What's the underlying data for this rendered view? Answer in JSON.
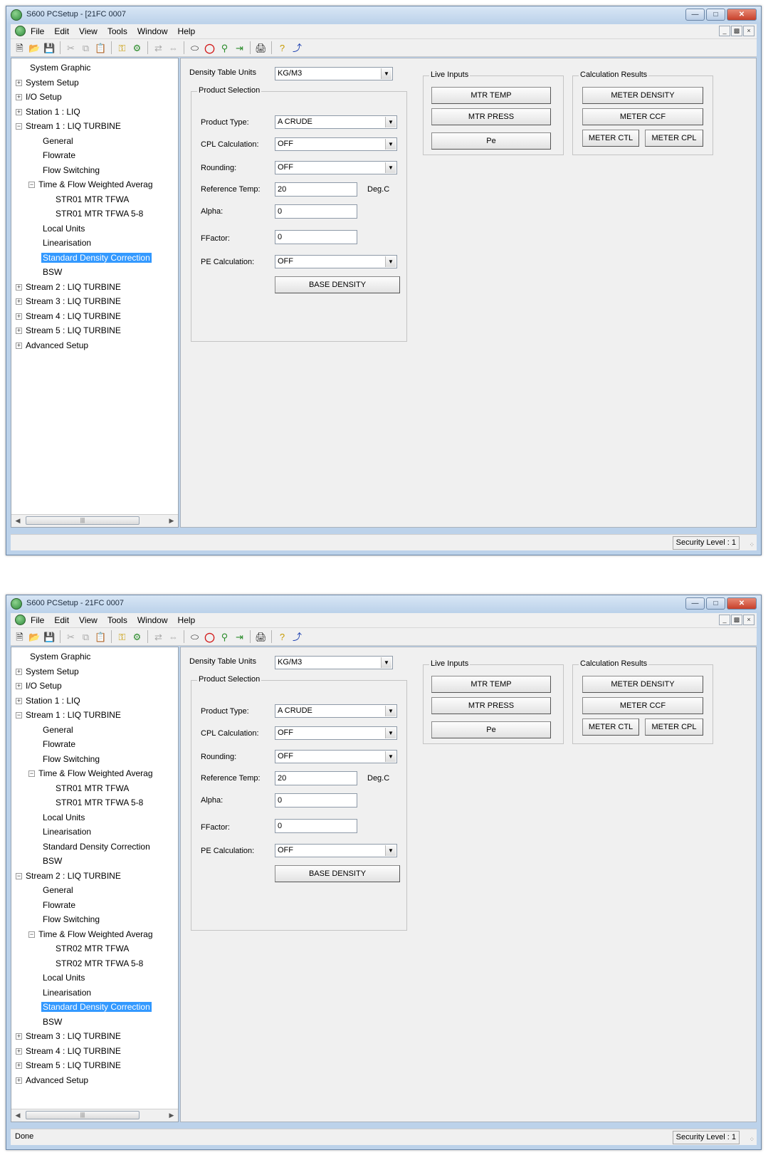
{
  "windows": [
    {
      "title": "S600 PCSetup - [21FC 0007",
      "menus": [
        "File",
        "Edit",
        "View",
        "Tools",
        "Window",
        "Help"
      ],
      "tree": [
        {
          "label": "System Graphic",
          "indent": 1,
          "expander": ""
        },
        {
          "label": "System Setup",
          "indent": 0,
          "expander": "+"
        },
        {
          "label": "I/O Setup",
          "indent": 0,
          "expander": "+"
        },
        {
          "label": "Station 1 : LIQ",
          "indent": 0,
          "expander": "+"
        },
        {
          "label": "Stream 1 : LIQ TURBINE",
          "indent": 0,
          "expander": "-"
        },
        {
          "label": "General",
          "indent": 2,
          "expander": ""
        },
        {
          "label": "Flowrate",
          "indent": 2,
          "expander": ""
        },
        {
          "label": "Flow Switching",
          "indent": 2,
          "expander": ""
        },
        {
          "label": "Time & Flow Weighted Averag",
          "indent": 1,
          "expander": "-"
        },
        {
          "label": "STR01 MTR TFWA",
          "indent": 3,
          "expander": ""
        },
        {
          "label": "STR01 MTR TFWA 5-8",
          "indent": 3,
          "expander": ""
        },
        {
          "label": "Local Units",
          "indent": 2,
          "expander": ""
        },
        {
          "label": "Linearisation",
          "indent": 2,
          "expander": ""
        },
        {
          "label": "Standard Density Correction",
          "indent": 2,
          "expander": "",
          "selected": true
        },
        {
          "label": "BSW",
          "indent": 2,
          "expander": ""
        },
        {
          "label": "Stream 2 : LIQ TURBINE",
          "indent": 0,
          "expander": "+"
        },
        {
          "label": "Stream 3 : LIQ TURBINE",
          "indent": 0,
          "expander": "+"
        },
        {
          "label": "Stream 4 : LIQ TURBINE",
          "indent": 0,
          "expander": "+"
        },
        {
          "label": "Stream 5 : LIQ TURBINE",
          "indent": 0,
          "expander": "+"
        },
        {
          "label": "Advanced Setup",
          "indent": 0,
          "expander": "+"
        }
      ],
      "form": {
        "density_table_units_label": "Density Table Units",
        "density_table_units_value": "KG/M3",
        "product_selection_label": "Product Selection",
        "product_type_label": "Product Type:",
        "product_type_value": "A CRUDE",
        "cpl_calc_label": "CPL Calculation:",
        "cpl_calc_value": "OFF",
        "rounding_label": "Rounding:",
        "rounding_value": "OFF",
        "ref_temp_label": "Reference Temp:",
        "ref_temp_value": "20",
        "ref_temp_unit": "Deg.C",
        "alpha_label": "Alpha:",
        "alpha_value": "0",
        "ffactor_label": "FFactor:",
        "ffactor_value": "0",
        "pe_calc_label": "PE Calculation:",
        "pe_calc_value": "OFF",
        "base_density_button": "BASE DENSITY",
        "live_inputs_label": "Live Inputs",
        "mtr_temp_button": "MTR TEMP",
        "mtr_press_button": "MTR PRESS",
        "pe_button": "Pe",
        "calc_results_label": "Calculation Results",
        "meter_density_button": "METER DENSITY",
        "meter_ccf_button": "METER CCF",
        "meter_ctl_button": "METER CTL",
        "meter_cpl_button": "METER CPL"
      },
      "status": {
        "left": "",
        "right": "Security Level : 1"
      }
    },
    {
      "title": "S600 PCSetup - 21FC 0007",
      "menus": [
        "File",
        "Edit",
        "View",
        "Tools",
        "Window",
        "Help"
      ],
      "tree": [
        {
          "label": "System Graphic",
          "indent": 1,
          "expander": ""
        },
        {
          "label": "System Setup",
          "indent": 0,
          "expander": "+"
        },
        {
          "label": "I/O Setup",
          "indent": 0,
          "expander": "+"
        },
        {
          "label": "Station 1 : LIQ",
          "indent": 0,
          "expander": "+"
        },
        {
          "label": "Stream 1 : LIQ TURBINE",
          "indent": 0,
          "expander": "-"
        },
        {
          "label": "General",
          "indent": 2,
          "expander": ""
        },
        {
          "label": "Flowrate",
          "indent": 2,
          "expander": ""
        },
        {
          "label": "Flow Switching",
          "indent": 2,
          "expander": ""
        },
        {
          "label": "Time & Flow Weighted Averag",
          "indent": 1,
          "expander": "-"
        },
        {
          "label": "STR01 MTR TFWA",
          "indent": 3,
          "expander": ""
        },
        {
          "label": "STR01 MTR TFWA 5-8",
          "indent": 3,
          "expander": ""
        },
        {
          "label": "Local Units",
          "indent": 2,
          "expander": ""
        },
        {
          "label": "Linearisation",
          "indent": 2,
          "expander": ""
        },
        {
          "label": "Standard Density Correction",
          "indent": 2,
          "expander": ""
        },
        {
          "label": "BSW",
          "indent": 2,
          "expander": ""
        },
        {
          "label": "Stream 2 : LIQ TURBINE",
          "indent": 0,
          "expander": "-"
        },
        {
          "label": "General",
          "indent": 2,
          "expander": ""
        },
        {
          "label": "Flowrate",
          "indent": 2,
          "expander": ""
        },
        {
          "label": "Flow Switching",
          "indent": 2,
          "expander": ""
        },
        {
          "label": "Time & Flow Weighted Averag",
          "indent": 1,
          "expander": "-"
        },
        {
          "label": "STR02 MTR TFWA",
          "indent": 3,
          "expander": ""
        },
        {
          "label": "STR02 MTR TFWA 5-8",
          "indent": 3,
          "expander": ""
        },
        {
          "label": "Local Units",
          "indent": 2,
          "expander": ""
        },
        {
          "label": "Linearisation",
          "indent": 2,
          "expander": ""
        },
        {
          "label": "Standard Density Correction",
          "indent": 2,
          "expander": "",
          "selected": true
        },
        {
          "label": "BSW",
          "indent": 2,
          "expander": ""
        },
        {
          "label": "Stream 3 : LIQ TURBINE",
          "indent": 0,
          "expander": "+"
        },
        {
          "label": "Stream 4 : LIQ TURBINE",
          "indent": 0,
          "expander": "+"
        },
        {
          "label": "Stream 5 : LIQ TURBINE",
          "indent": 0,
          "expander": "+"
        },
        {
          "label": "Advanced Setup",
          "indent": 0,
          "expander": "+"
        }
      ],
      "form": {
        "density_table_units_label": "Density Table Units",
        "density_table_units_value": "KG/M3",
        "product_selection_label": "Product Selection",
        "product_type_label": "Product Type:",
        "product_type_value": "A CRUDE",
        "cpl_calc_label": "CPL Calculation:",
        "cpl_calc_value": "OFF",
        "rounding_label": "Rounding:",
        "rounding_value": "OFF",
        "ref_temp_label": "Reference Temp:",
        "ref_temp_value": "20",
        "ref_temp_unit": "Deg.C",
        "alpha_label": "Alpha:",
        "alpha_value": "0",
        "ffactor_label": "FFactor:",
        "ffactor_value": "0",
        "pe_calc_label": "PE Calculation:",
        "pe_calc_value": "OFF",
        "base_density_button": "BASE DENSITY",
        "live_inputs_label": "Live Inputs",
        "mtr_temp_button": "MTR TEMP",
        "mtr_press_button": "MTR PRESS",
        "pe_button": "Pe",
        "calc_results_label": "Calculation Results",
        "meter_density_button": "METER DENSITY",
        "meter_ccf_button": "METER CCF",
        "meter_ctl_button": "METER CTL",
        "meter_cpl_button": "METER CPL"
      },
      "status": {
        "left": "Done",
        "right": "Security Level : 1"
      }
    }
  ]
}
